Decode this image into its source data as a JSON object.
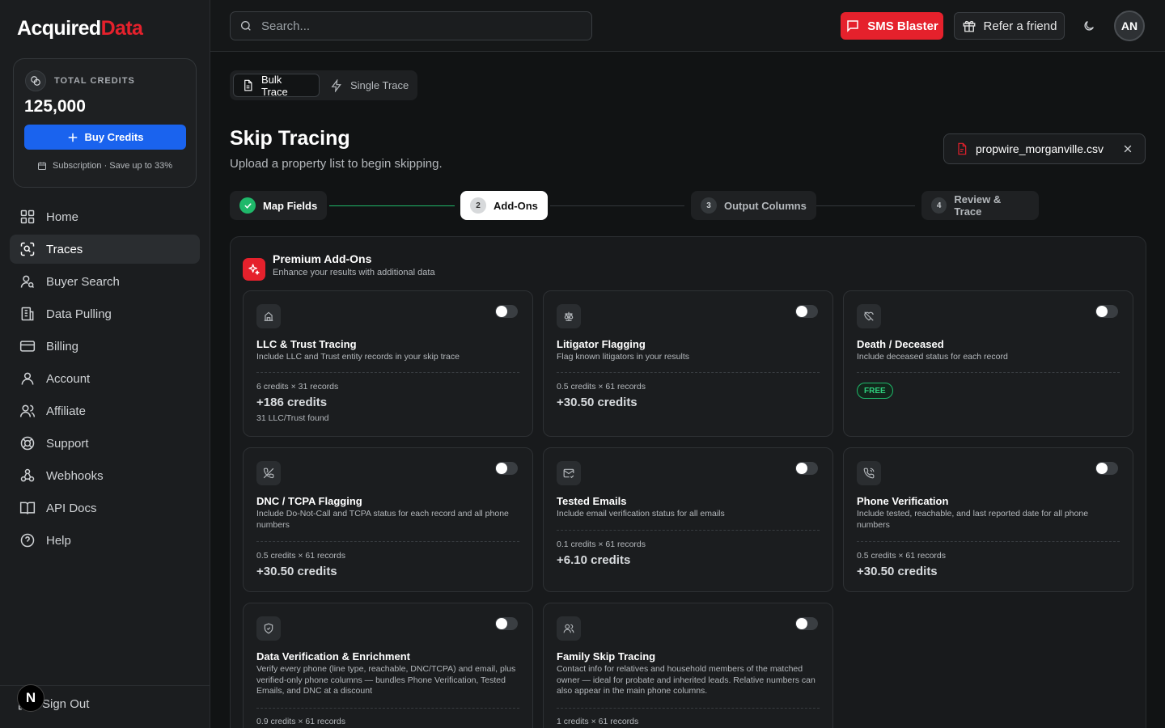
{
  "brand": {
    "name_main": "Acquired",
    "name_accent": "Data",
    "accent_color": "#e5212c"
  },
  "credits": {
    "label": "TOTAL CREDITS",
    "value": "125,000",
    "buy_label": "Buy Credits",
    "subscription": "Subscription · Save up to 33%"
  },
  "nav": {
    "items": [
      {
        "label": "Home",
        "icon": "home-icon"
      },
      {
        "label": "Traces",
        "icon": "trace-icon",
        "active": true
      },
      {
        "label": "Buyer Search",
        "icon": "user-search-icon"
      },
      {
        "label": "Data Pulling",
        "icon": "building-icon"
      },
      {
        "label": "Billing",
        "icon": "credit-card-icon"
      },
      {
        "label": "Account",
        "icon": "user-icon"
      },
      {
        "label": "Affiliate",
        "icon": "users-icon"
      },
      {
        "label": "Support",
        "icon": "lifebuoy-icon"
      },
      {
        "label": "Webhooks",
        "icon": "webhook-icon"
      },
      {
        "label": "API Docs",
        "icon": "book-icon"
      },
      {
        "label": "Help",
        "icon": "help-icon"
      }
    ],
    "signout": "Sign Out",
    "badge": "N"
  },
  "topbar": {
    "search_placeholder": "Search...",
    "sms_label": "SMS Blaster",
    "refer_label": "Refer a friend",
    "avatar": "AN"
  },
  "mode_tabs": {
    "bulk": "Bulk Trace",
    "single": "Single Trace"
  },
  "page": {
    "title": "Skip Tracing",
    "subtitle": "Upload a property list to begin skipping.",
    "file_name": "propwire_morganville.csv"
  },
  "steps": [
    {
      "num": "1",
      "label": "Map Fields",
      "state": "done"
    },
    {
      "num": "2",
      "label": "Add-Ons",
      "state": "current"
    },
    {
      "num": "3",
      "label": "Output Columns",
      "state": "todo"
    },
    {
      "num": "4",
      "label": "Review & Trace",
      "state": "todo"
    }
  ],
  "addons": {
    "title": "Premium Add-Ons",
    "subtitle": "Enhance your results with additional data",
    "cards": [
      {
        "title": "LLC & Trust Tracing",
        "desc": "Include LLC and Trust entity records in your skip trace",
        "rate": "6 credits × 31 records",
        "cost": "+186 credits",
        "note": "31 LLC/Trust found",
        "icon": "building-icon",
        "enabled": false
      },
      {
        "title": "Litigator Flagging",
        "desc": "Flag known litigators in your results",
        "rate": "0.5 credits × 61 records",
        "cost": "+30.50 credits",
        "icon": "scale-icon",
        "enabled": false
      },
      {
        "title": "Death / Deceased",
        "desc": "Include deceased status for each record",
        "badge": "FREE",
        "icon": "heart-off-icon",
        "enabled": false
      },
      {
        "title": "DNC / TCPA Flagging",
        "desc": "Include Do-Not-Call and TCPA status for each record and all phone numbers",
        "rate": "0.5 credits × 61 records",
        "cost": "+30.50 credits",
        "icon": "phone-off-icon",
        "enabled": false
      },
      {
        "title": "Tested Emails",
        "desc": "Include email verification status for all emails",
        "rate": "0.1 credits × 61 records",
        "cost": "+6.10 credits",
        "icon": "mail-check-icon",
        "enabled": false
      },
      {
        "title": "Phone Verification",
        "desc": "Include tested, reachable, and last reported date for all phone numbers",
        "rate": "0.5 credits × 61 records",
        "cost": "+30.50 credits",
        "icon": "phone-call-icon",
        "enabled": false
      },
      {
        "title": "Data Verification & Enrichment",
        "desc": "Verify every phone (line type, reachable, DNC/TCPA) and email, plus verified-only phone columns — bundles Phone Verification, Tested Emails, and DNC at a discount",
        "rate": "0.9 credits × 61 records",
        "icon": "shield-check-icon",
        "enabled": false
      },
      {
        "title": "Family Skip Tracing",
        "desc": "Contact info for relatives and household members of the matched owner — ideal for probate and inherited leads. Relative numbers can also appear in the main phone columns.",
        "rate": "1 credits × 61 records",
        "icon": "users-icon",
        "enabled": false
      }
    ]
  }
}
